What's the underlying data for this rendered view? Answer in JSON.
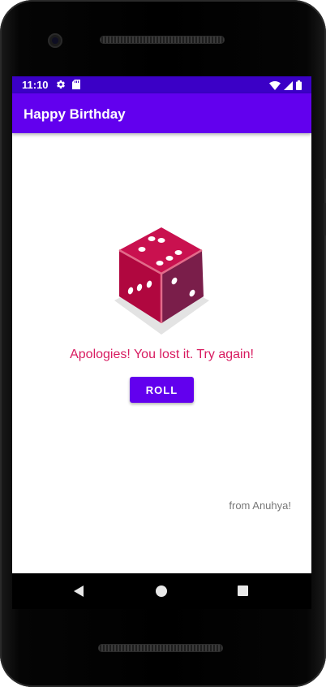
{
  "status_bar": {
    "time": "11:10",
    "icons": [
      "gear-icon",
      "sd-card-icon",
      "wifi-icon",
      "cell-signal-icon",
      "battery-icon"
    ],
    "color": "#3b00c6"
  },
  "app_bar": {
    "title": "Happy Birthday",
    "color": "#6200ee"
  },
  "main": {
    "dice_image": "dice-icon",
    "result_text": "Apologies! You lost it. Try again!",
    "result_color": "#d81b60",
    "roll_button_label": "ROLL",
    "signature": "from Anuhya!"
  },
  "nav_bar": {
    "icons": [
      "back-icon",
      "home-icon",
      "recents-icon"
    ]
  }
}
